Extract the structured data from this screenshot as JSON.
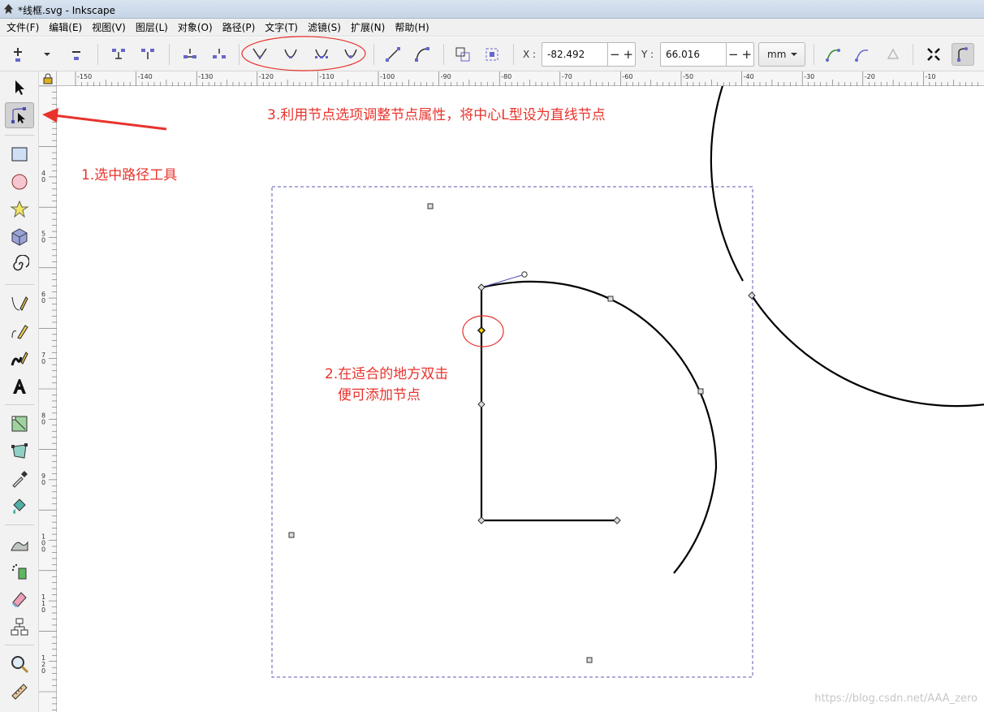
{
  "window": {
    "title": "*线框.svg - Inkscape"
  },
  "menus": [
    "文件(F)",
    "编辑(E)",
    "视图(V)",
    "图层(L)",
    "对象(O)",
    "路径(P)",
    "文字(T)",
    "滤镜(S)",
    "扩展(N)",
    "帮助(H)"
  ],
  "node_toolbar": {
    "x_label": "X :",
    "x_value": "-82.492",
    "y_label": "Y :",
    "y_value": "66.016",
    "unit": "mm"
  },
  "ruler": {
    "h_ticks": [
      "-150",
      "-140",
      "-130",
      "-120",
      "-110",
      "-100",
      "-90",
      "-80",
      "-70",
      "-60",
      "-50",
      "-40",
      "-30",
      "-20",
      "-10"
    ],
    "v_ticks": [
      "4\n0",
      "5\n0",
      "6\n0",
      "7\n0",
      "8\n0",
      "9\n0",
      "1\n0\n0",
      "1\n1\n0",
      "1\n2\n0"
    ]
  },
  "annotations": {
    "step1": "1.选中路径工具",
    "step2_line1": "2.在适合的地方双击",
    "step2_line2": "便可添加节点",
    "step3": "3.利用节点选项调整节点属性，将中心L型设为直线节点"
  },
  "watermark": "https://blog.csdn.net/AAA_zero",
  "colors": {
    "annotation": "#e8332c",
    "selection": "#5b5bb0",
    "handle": "#4a4ab0"
  }
}
